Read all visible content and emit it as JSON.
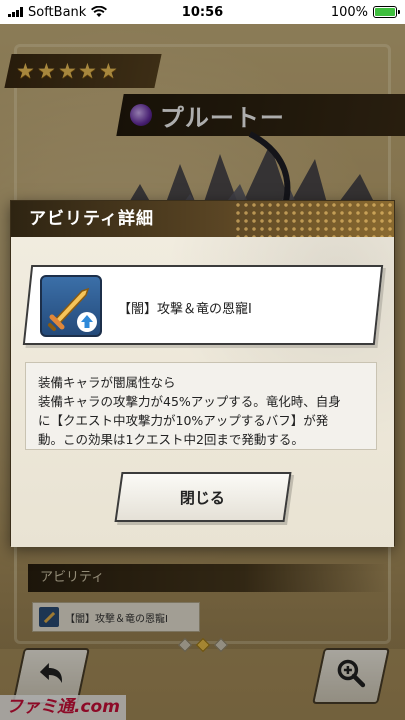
{
  "status_bar": {
    "carrier": "SoftBank",
    "time": "10:56",
    "battery": "100%",
    "battery_level": 1.0
  },
  "background": {
    "stars": [
      "★",
      "★",
      "★",
      "★",
      "★"
    ],
    "character_name": "プルートー",
    "element_icon": "dark-element-orb-icon",
    "section_heading": "アビリティ",
    "ability_label": "【闇】攻撃＆竜の恩寵Ⅰ",
    "pager_dots": 3,
    "pager_active_index": 1,
    "back_icon": "back-arrow-icon",
    "zoom_icon": "zoom-in-icon",
    "watermark": "ファミ通.com"
  },
  "dialog": {
    "title": "アビリティ詳細",
    "ability_name": "【闇】攻撃＆竜の恩寵Ⅰ",
    "ability_icon": "sword-attack-up-icon",
    "description": [
      "装備キャラが闇属性なら",
      "装備キャラの攻撃力が45%アップする。竜化時、自身",
      "に【クエスト中攻撃力が10%アップするバフ】が発",
      "動。この効果は1クエスト中2回まで発動する。"
    ],
    "close_label": "閉じる"
  },
  "colors": {
    "header_dark": "#2e2412",
    "header_gold": "#8a6a30",
    "star_gold": "#f6c85a",
    "accent_blue": "#3b6fa8"
  }
}
